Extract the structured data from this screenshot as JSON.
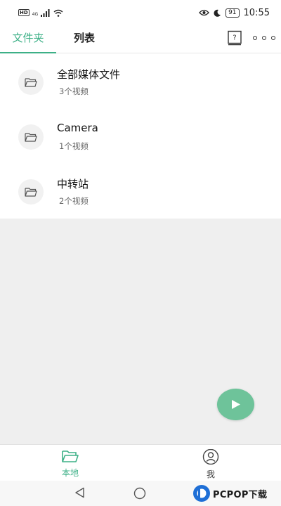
{
  "status_bar": {
    "hd_label": "HD",
    "network_type": "4G",
    "battery": "91",
    "time": "10:55"
  },
  "tabs": {
    "folder": "文件夹",
    "list": "列表"
  },
  "help_icon_char": "?",
  "folders": [
    {
      "name": "全部媒体文件",
      "count": "3个视频"
    },
    {
      "name": "Camera",
      "count": "1个视频"
    },
    {
      "name": "中转站",
      "count": "2个视频"
    }
  ],
  "bottom_nav": {
    "local": "本地",
    "me": "我"
  },
  "watermark": {
    "text": "PCPOP下载"
  },
  "colors": {
    "accent": "#3db087",
    "fab": "#6ec39a",
    "empty_bg": "#efefef"
  }
}
